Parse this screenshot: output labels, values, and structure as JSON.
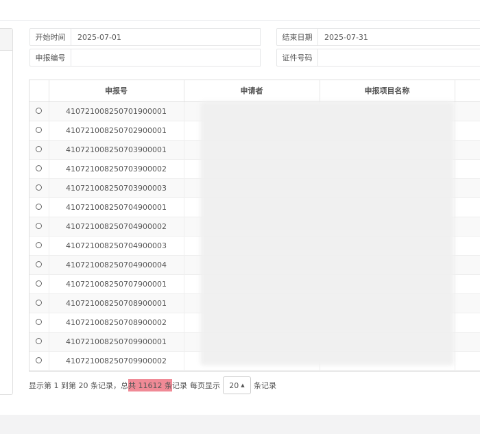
{
  "filters": {
    "start_label": "开始时间",
    "start_value": "2025-07-01",
    "end_label": "结束日期",
    "end_value": "2025-07-31",
    "code_label": "申报编号",
    "code_value": "",
    "cert_label": "证件号码",
    "cert_value": ""
  },
  "table": {
    "columns": [
      "申报号",
      "申请者",
      "申报项目名称"
    ],
    "rows": [
      {
        "id": "410721008250701900001"
      },
      {
        "id": "410721008250702900001"
      },
      {
        "id": "410721008250703900001"
      },
      {
        "id": "410721008250703900002"
      },
      {
        "id": "410721008250703900003"
      },
      {
        "id": "410721008250704900001"
      },
      {
        "id": "410721008250704900002"
      },
      {
        "id": "410721008250704900003"
      },
      {
        "id": "410721008250704900004"
      },
      {
        "id": "410721008250707900001"
      },
      {
        "id": "410721008250708900001"
      },
      {
        "id": "410721008250708900002"
      },
      {
        "id": "410721008250709900001"
      },
      {
        "id": "410721008250709900002"
      }
    ]
  },
  "pagination": {
    "prefix": "显示第 1 到第 20 条记录，总",
    "highlight": "共 11612 条",
    "suffix": "记录",
    "per_page_label": "每页显示",
    "page_size": "20",
    "records_label": "条记录"
  }
}
